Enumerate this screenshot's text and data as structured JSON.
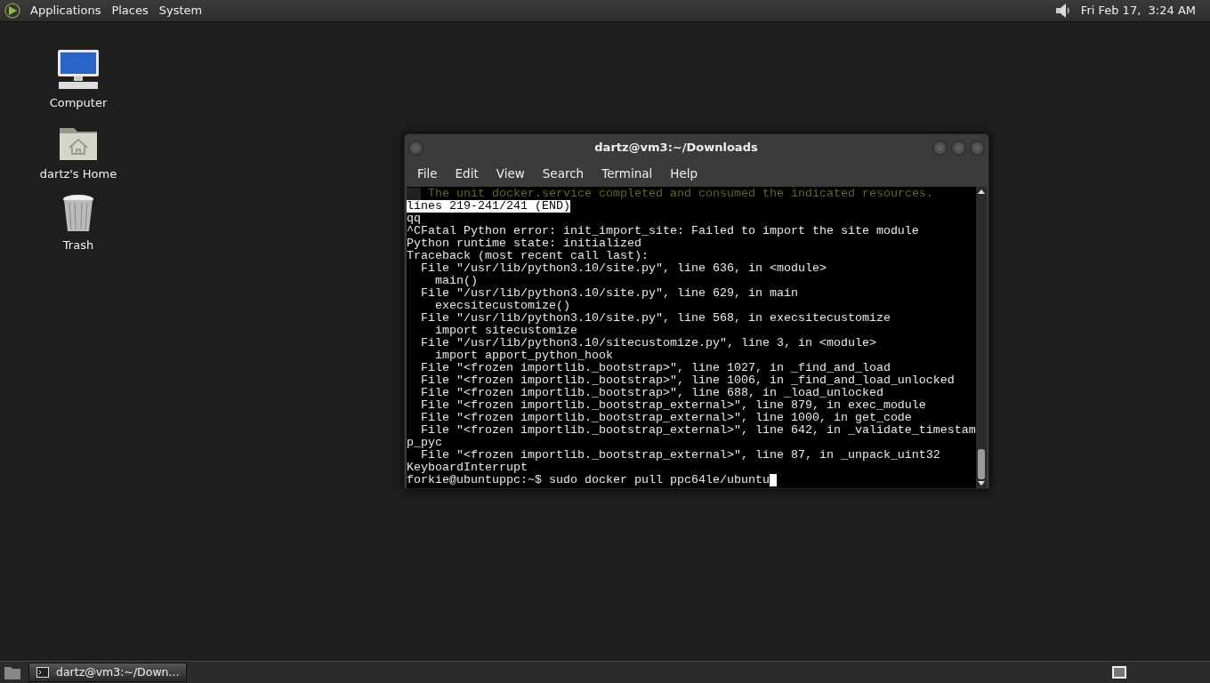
{
  "top_panel": {
    "menus": [
      "Applications",
      "Places",
      "System"
    ],
    "clock": "Fri Feb 17,  3:24 AM"
  },
  "desktop_icons": [
    {
      "kind": "computer",
      "label": "Computer"
    },
    {
      "kind": "home",
      "label": "dartz's Home"
    },
    {
      "kind": "trash",
      "label": "Trash"
    }
  ],
  "window": {
    "title": "dartz@vm3:~/Downloads",
    "menu": [
      "File",
      "Edit",
      "View",
      "Search",
      "Terminal",
      "Help"
    ],
    "terminal_lines": [
      {
        "kind": "dim",
        "text": "The unit docker.service completed and consumed the indicated resources."
      },
      {
        "kind": "inverse",
        "text": "lines 219-241/241 (END)"
      },
      {
        "kind": "normal",
        "text": "qq"
      },
      {
        "kind": "normal",
        "text": "^CFatal Python error: init_import_site: Failed to import the site module"
      },
      {
        "kind": "normal",
        "text": "Python runtime state: initialized"
      },
      {
        "kind": "normal",
        "text": "Traceback (most recent call last):"
      },
      {
        "kind": "normal",
        "text": "  File \"/usr/lib/python3.10/site.py\", line 636, in <module>"
      },
      {
        "kind": "normal",
        "text": "    main()"
      },
      {
        "kind": "normal",
        "text": "  File \"/usr/lib/python3.10/site.py\", line 629, in main"
      },
      {
        "kind": "normal",
        "text": "    execsitecustomize()"
      },
      {
        "kind": "normal",
        "text": "  File \"/usr/lib/python3.10/site.py\", line 568, in execsitecustomize"
      },
      {
        "kind": "normal",
        "text": "    import sitecustomize"
      },
      {
        "kind": "normal",
        "text": "  File \"/usr/lib/python3.10/sitecustomize.py\", line 3, in <module>"
      },
      {
        "kind": "normal",
        "text": "    import apport_python_hook"
      },
      {
        "kind": "normal",
        "text": "  File \"<frozen importlib._bootstrap>\", line 1027, in _find_and_load"
      },
      {
        "kind": "normal",
        "text": "  File \"<frozen importlib._bootstrap>\", line 1006, in _find_and_load_unlocked"
      },
      {
        "kind": "normal",
        "text": "  File \"<frozen importlib._bootstrap>\", line 688, in _load_unlocked"
      },
      {
        "kind": "normal",
        "text": "  File \"<frozen importlib._bootstrap_external>\", line 879, in exec_module"
      },
      {
        "kind": "normal",
        "text": "  File \"<frozen importlib._bootstrap_external>\", line 1000, in get_code"
      },
      {
        "kind": "normal",
        "text": "  File \"<frozen importlib._bootstrap_external>\", line 642, in _validate_timestam"
      },
      {
        "kind": "normal",
        "text": "p_pyc"
      },
      {
        "kind": "normal",
        "text": "  File \"<frozen importlib._bootstrap_external>\", line 87, in _unpack_uint32"
      },
      {
        "kind": "normal",
        "text": "KeyboardInterrupt"
      },
      {
        "kind": "prompt",
        "text": "forkie@ubuntuppc:~$ sudo docker pull ppc64le/ubuntu"
      }
    ]
  },
  "taskbar": {
    "tasks": [
      {
        "label": "dartz@vm3:~/Down...",
        "selected": true
      }
    ]
  }
}
